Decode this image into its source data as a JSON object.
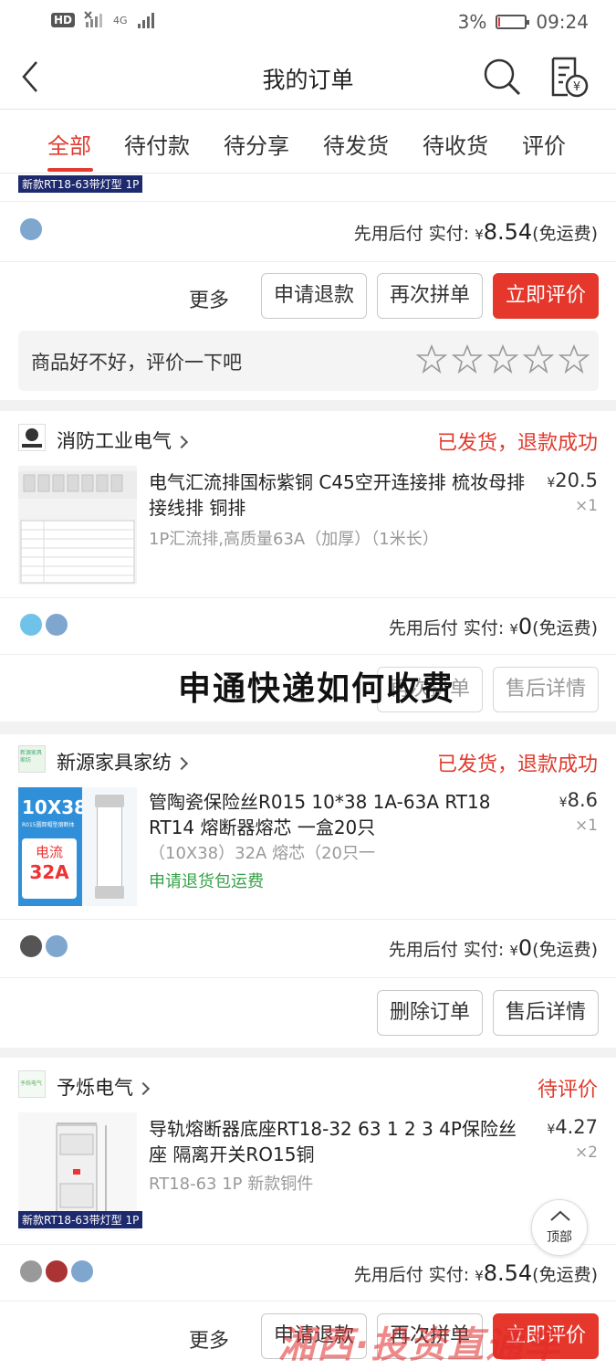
{
  "status_bar": {
    "left_badge": "HD",
    "network": "4G",
    "battery": "3%",
    "time": "09:24"
  },
  "header": {
    "title": "我的订单"
  },
  "tabs": [
    {
      "label": "全部",
      "active": true
    },
    {
      "label": "待付款",
      "active": false
    },
    {
      "label": "待分享",
      "active": false
    },
    {
      "label": "待发货",
      "active": false
    },
    {
      "label": "待收货",
      "active": false
    },
    {
      "label": "评价",
      "active": false
    }
  ],
  "orders": [
    {
      "spec_tag": "新款RT18-63带灯型 1P",
      "pay_prefix": "先用后付 实付:",
      "amount": "8.54",
      "shipping": "(免运费)",
      "buttons": {
        "more": "更多",
        "refund": "申请退款",
        "rebuy": "再次拼单",
        "review": "立即评价"
      },
      "review_prompt": "商品好不好，评价一下吧"
    },
    {
      "shop": "消防工业电气",
      "shop_logo_text": "消防工业电气",
      "status": "已发货，退款成功",
      "title": "电气汇流排国标紫铜 C45空开连接排 梳妆母排 接线排 铜排",
      "spec": "1P汇流排,高质量63A（加厚）（1米长）",
      "price": "20.5",
      "qty": "×1",
      "pay_prefix": "先用后付 实付:",
      "amount": "0",
      "shipping": "(免运费)",
      "buttons": {
        "rebuy": "再次拼单",
        "after_sale": "售后详情"
      }
    },
    {
      "shop": "新源家具家纺",
      "shop_logo_text": "新源家具家纺",
      "status": "已发货，退款成功",
      "title": "管陶瓷保险丝R015 10*38 1A-63A RT18 RT14 熔断器熔芯 一盒20只",
      "spec": "（10X38）32A 熔芯（20只一",
      "note": "申请退货包运费",
      "price": "8.6",
      "qty": "×1",
      "thumb_big": "10X38",
      "thumb_sub": "R015圆筒帽型熔断体",
      "thumb_label1": "电流",
      "thumb_label2": "32A",
      "pay_prefix": "先用后付 实付:",
      "amount": "0",
      "shipping": "(免运费)",
      "buttons": {
        "delete": "删除订单",
        "after_sale": "售后详情"
      }
    },
    {
      "shop": "予烁电气",
      "shop_logo_text": "予烁电气",
      "status": "待评价",
      "title": "导轨熔断器底座RT18-32 63 1 2 3 4P保险丝座 隔离开关RO15铜",
      "spec": "RT18-63 1P 新款铜件",
      "price": "4.27",
      "qty": "×2",
      "spec_tag": "新款RT18-63带灯型 1P",
      "pay_prefix": "先用后付 实付:",
      "amount": "8.54",
      "shipping": "(免运费)",
      "buttons": {
        "more": "更多",
        "refund": "申请退款",
        "rebuy": "再次拼单",
        "review": "立即评价"
      }
    }
  ],
  "currency": "¥",
  "overlay_title": "申通快递如何收费",
  "back_to_top": "顶部",
  "watermark": "湘西·投资直通车",
  "colors": {
    "accent": "#e33b2e",
    "green": "#36a24a",
    "tag_bg": "#1e2a6e"
  }
}
